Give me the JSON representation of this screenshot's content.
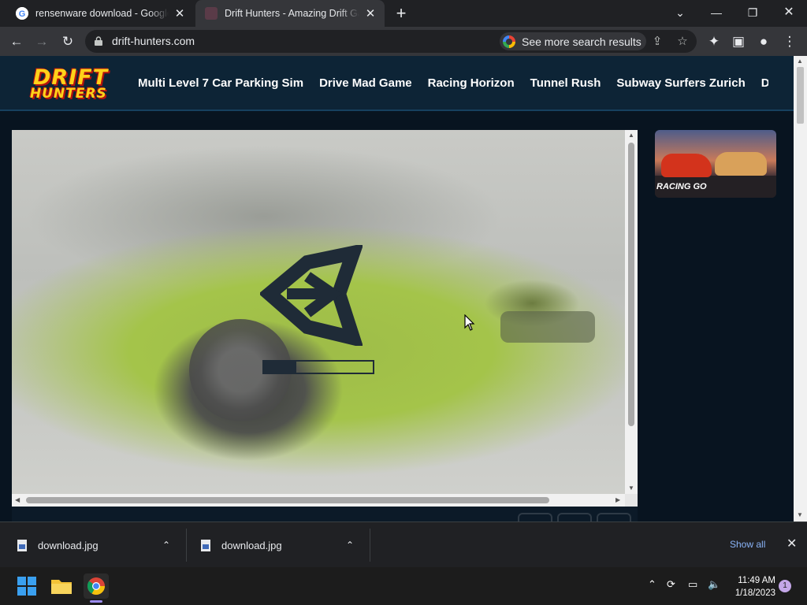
{
  "browser": {
    "tabs": [
      {
        "title": "rensenware download - Google S",
        "active": false,
        "favicon": "google-icon"
      },
      {
        "title": "Drift Hunters - Amazing Drift Gar",
        "active": true,
        "favicon": "drift-hunters-favicon"
      }
    ],
    "new_tab_label": "+",
    "window_controls": [
      "chevron-down-icon",
      "minimize-icon",
      "restore-icon",
      "close-icon"
    ],
    "url": "drift-hunters.com",
    "search_chip": "See more search results"
  },
  "site": {
    "logo_line1": "DRIFT",
    "logo_line2": "HUNTERS",
    "nav": [
      "Multi Level 7 Car Parking Sim",
      "Drive Mad Game",
      "Racing Horizon",
      "Tunnel Rush",
      "Subway Surfers Zurich",
      "Dr"
    ],
    "game": {
      "loading_progress": 0.3,
      "engine_logo": "unity-logo"
    },
    "sidebar_thumb_label": "RACING GO"
  },
  "downloads": {
    "items": [
      {
        "name": "download.jpg"
      },
      {
        "name": "download.jpg"
      }
    ],
    "show_all": "Show all"
  },
  "taskbar": {
    "time": "11:49 AM",
    "date": "1/18/2023",
    "notifications": "1"
  },
  "colors": {
    "accent": "#8ab4f8",
    "site_bg": "#081420",
    "nav_bg": "#0d2436",
    "logo_yellow": "#ffd21a"
  }
}
